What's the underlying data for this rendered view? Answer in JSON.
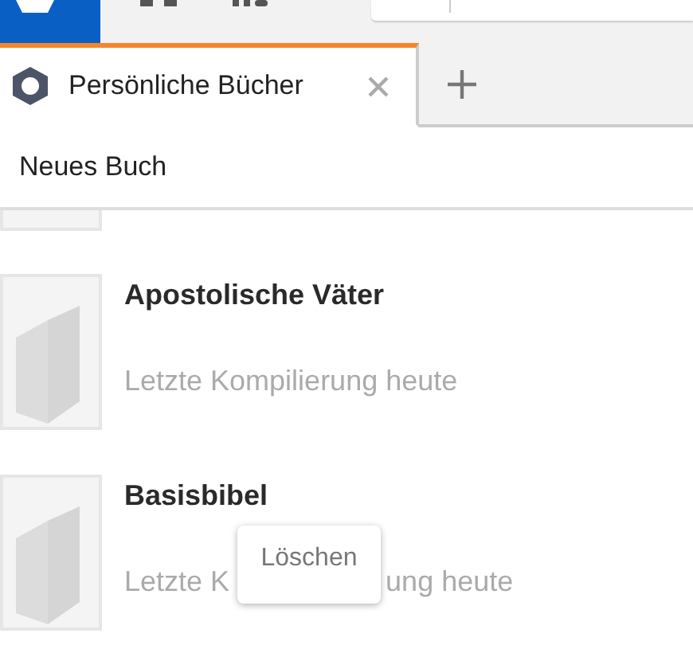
{
  "tabs": [
    {
      "label": "Persönliche Bücher",
      "selected": true
    }
  ],
  "toolbar": {
    "new_book": "Neues Buch"
  },
  "books": [
    {
      "title": "Apostolische Väter",
      "subtitle": [
        "Letzte Kompilierung heute"
      ]
    },
    {
      "title": "Basisbibel",
      "subtitle": [
        "Letzte K",
        "ung heute"
      ]
    }
  ],
  "tooltip": "Löschen"
}
